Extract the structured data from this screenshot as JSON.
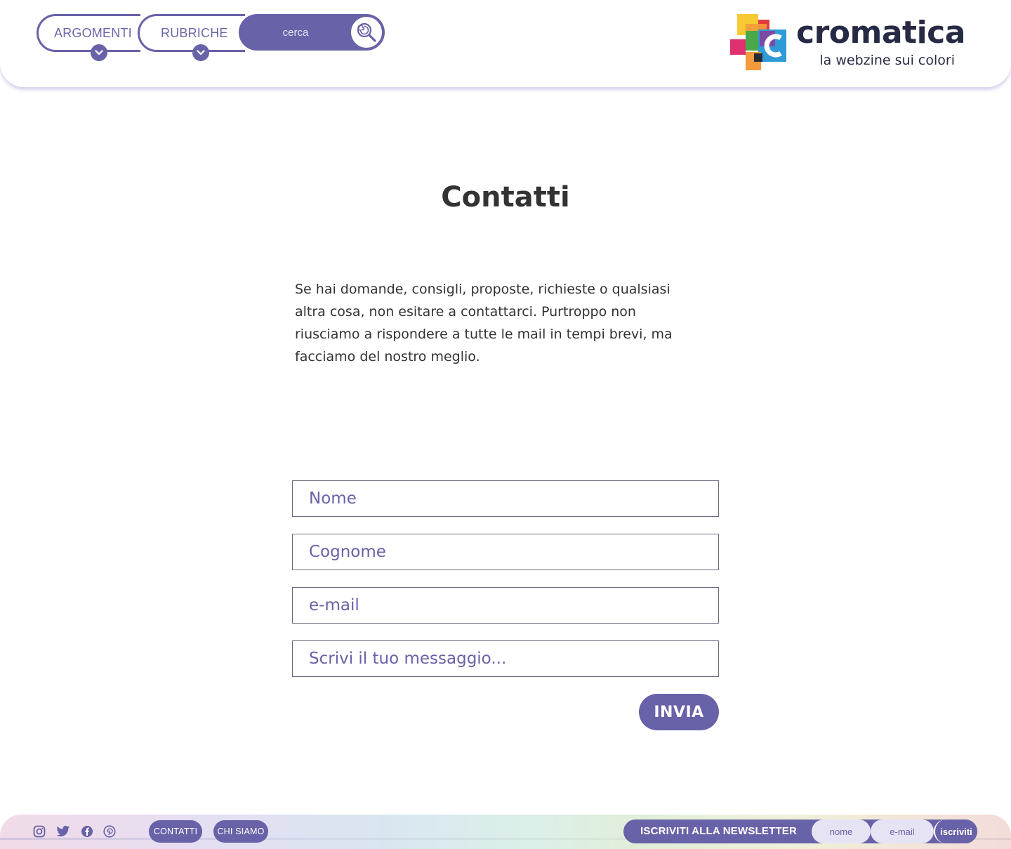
{
  "nav": {
    "topics_label": "ARGOMENTI",
    "sections_label": "RUBRICHE",
    "search_placeholder": "cerca"
  },
  "brand": {
    "name": "cromatica",
    "tagline": "la webzine sui colori"
  },
  "main": {
    "title": "Contatti",
    "intro": "Se hai domande, consigli, proposte, richieste o qualsiasi altra cosa, non esitare a contattarci. Purtroppo non riusciamo a rispondere a tutte le mail in tempi brevi, ma facciamo del nostro meglio."
  },
  "form": {
    "first_name_placeholder": "Nome",
    "last_name_placeholder": "Cognome",
    "email_placeholder": "e-mail",
    "message_placeholder": "Scrivi il tuo messaggio...",
    "submit_label": "INVIA"
  },
  "footer": {
    "social_icons": [
      "instagram-icon",
      "twitter-icon",
      "facebook-icon",
      "pinterest-icon"
    ],
    "links": [
      "CONTATTI",
      "CHI SIAMO"
    ],
    "newsletter": {
      "title": "ISCRIVITI ALLA NEWSLETTER",
      "name_placeholder": "nome",
      "email_placeholder": "e-mail",
      "submit_label": "iscriviti"
    }
  },
  "colors": {
    "accent": "#6862a8",
    "text": "#333333",
    "logo_text": "#262a44"
  }
}
